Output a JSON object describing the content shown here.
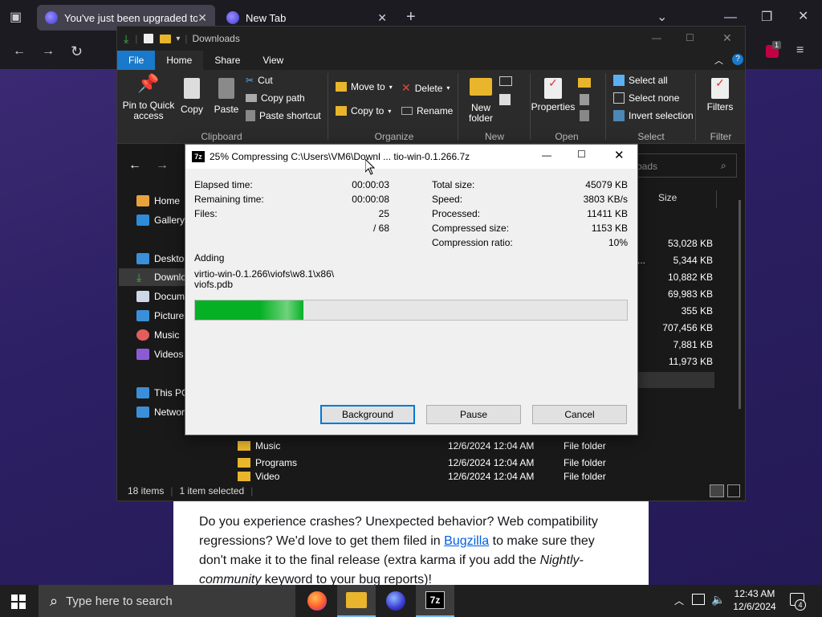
{
  "browser": {
    "tabs": [
      {
        "label": "You've just been upgraded to F"
      },
      {
        "label": "New Tab"
      }
    ],
    "notification_badge": "1"
  },
  "article": {
    "text_before_link": "Do you experience crashes? Unexpected behavior? Web compatibility regressions? We'd love to get them filed in ",
    "link": "Bugzilla",
    "text_after_link": " to make sure they don't make it to the final release (extra karma if you add the ",
    "italic": "Nightly-community",
    "text_end": " keyword to your bug reports)!"
  },
  "explorer": {
    "title": "Downloads",
    "ribbon_tabs": [
      "File",
      "Home",
      "Share",
      "View"
    ],
    "clipboard": {
      "pin": "Pin to Quick access",
      "copy": "Copy",
      "paste": "Paste",
      "cut": "Cut",
      "copy_path": "Copy path",
      "paste_shortcut": "Paste shortcut",
      "group": "Clipboard"
    },
    "organize": {
      "move_to": "Move to",
      "copy_to": "Copy to",
      "delete": "Delete",
      "rename": "Rename",
      "group": "Organize"
    },
    "new": {
      "new_folder": "New folder",
      "group": "New"
    },
    "open": {
      "properties": "Properties",
      "group": "Open"
    },
    "select": {
      "select_all": "Select all",
      "select_none": "Select none",
      "invert": "Invert selection",
      "group": "Select"
    },
    "filter": {
      "filters": "Filters",
      "group": "Filter"
    },
    "search_placeholder": "oads",
    "size_header": "Size",
    "nav": [
      "Home",
      "Gallery",
      "Desktop",
      "Downloads",
      "Documents",
      "Pictures",
      "Music",
      "Videos",
      "This PC",
      "Network"
    ],
    "sizes": [
      "53,028 KB",
      "5,344 KB",
      "10,882 KB",
      "69,983 KB",
      "355 KB",
      "707,456 KB",
      "7,881 KB",
      "11,973 KB"
    ],
    "partial_name": "...",
    "folders": [
      {
        "name": "Music",
        "date": "12/6/2024 12:04 AM",
        "type": "File folder"
      },
      {
        "name": "Programs",
        "date": "12/6/2024 12:04 AM",
        "type": "File folder"
      },
      {
        "name": "Video",
        "date": "12/6/2024 12:04 AM",
        "type": "File folder"
      }
    ],
    "status": {
      "items": "18 items",
      "selected": "1 item selected"
    }
  },
  "dialog": {
    "title": "25% Compressing C:\\Users\\VM6\\Downl ... tio-win-0.1.266.7z",
    "left_stats": [
      {
        "label": "Elapsed time:",
        "value": "00:00:03"
      },
      {
        "label": "Remaining time:",
        "value": "00:00:08"
      },
      {
        "label": "Files:",
        "value": "25"
      },
      {
        "label": "",
        "value": "/ 68"
      }
    ],
    "right_stats": [
      {
        "label": "Total size:",
        "value": "45079 KB"
      },
      {
        "label": "Speed:",
        "value": "3803 KB/s"
      },
      {
        "label": "Processed:",
        "value": "11411 KB"
      },
      {
        "label": "Compressed size:",
        "value": "1153 KB"
      },
      {
        "label": "Compression ratio:",
        "value": "10%"
      }
    ],
    "adding_label": "Adding",
    "path_line1": "virtio-win-0.1.266\\viofs\\w8.1\\x86\\",
    "path_line2": "viofs.pdb",
    "progress": 0.25,
    "buttons": {
      "background": "Background",
      "pause": "Pause",
      "cancel": "Cancel"
    }
  },
  "taskbar": {
    "search_placeholder": "Type here to search",
    "time": "12:43 AM",
    "date": "12/6/2024",
    "notification_count": "4"
  }
}
